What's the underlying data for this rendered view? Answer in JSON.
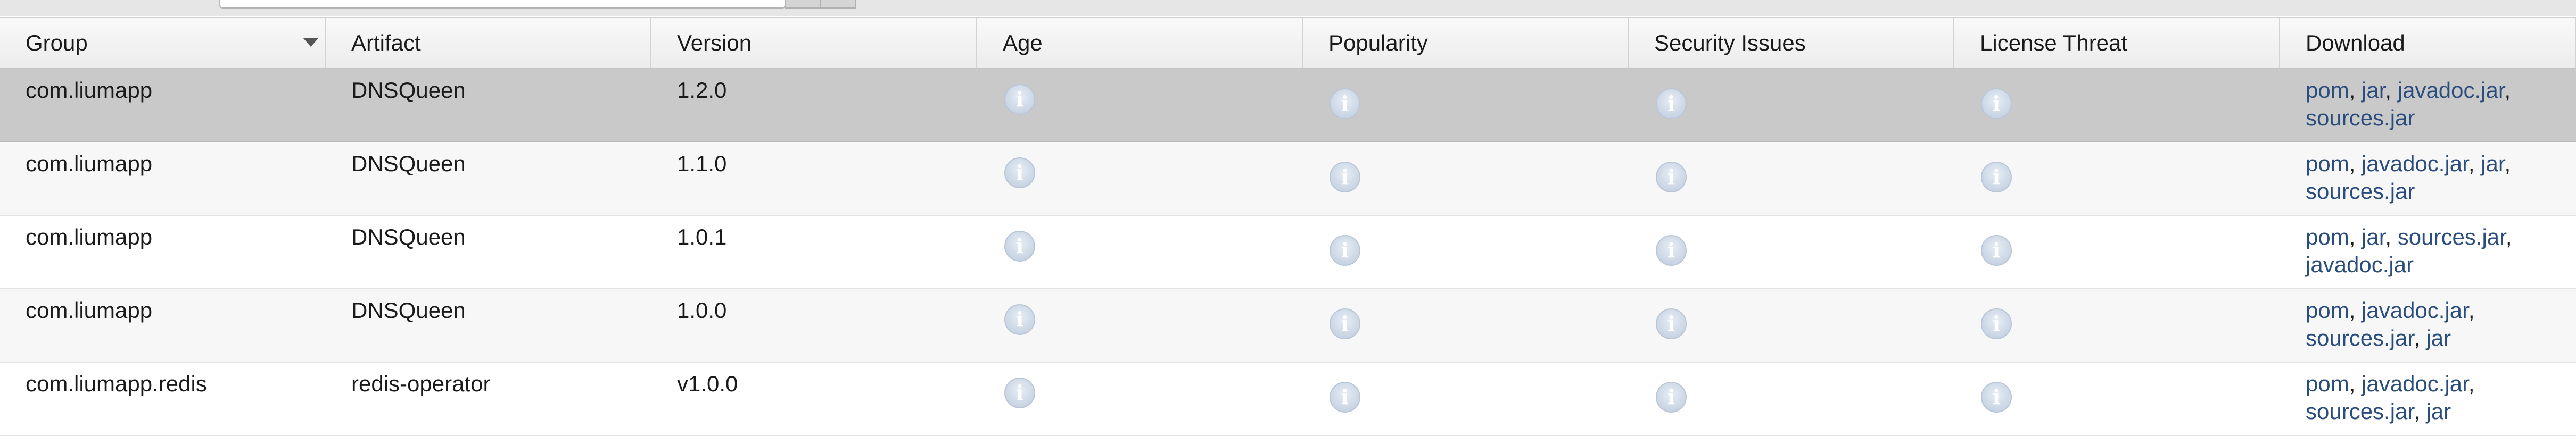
{
  "table": {
    "columns": [
      {
        "label": "Group",
        "sortable": true
      },
      {
        "label": "Artifact"
      },
      {
        "label": "Version"
      },
      {
        "label": "Age"
      },
      {
        "label": "Popularity"
      },
      {
        "label": "Security Issues"
      },
      {
        "label": "License Threat"
      },
      {
        "label": "Download"
      }
    ],
    "rows": [
      {
        "group": "com.liumapp",
        "artifact": "DNSQueen",
        "version": "1.2.0",
        "selected": true,
        "downloads": [
          "pom",
          "jar",
          "javadoc.jar",
          "sources.jar"
        ]
      },
      {
        "group": "com.liumapp",
        "artifact": "DNSQueen",
        "version": "1.1.0",
        "downloads": [
          "pom",
          "javadoc.jar",
          "jar",
          "sources.jar"
        ]
      },
      {
        "group": "com.liumapp",
        "artifact": "DNSQueen",
        "version": "1.0.1",
        "downloads": [
          "pom",
          "jar",
          "sources.jar",
          "javadoc.jar"
        ]
      },
      {
        "group": "com.liumapp",
        "artifact": "DNSQueen",
        "version": "1.0.0",
        "downloads": [
          "pom",
          "javadoc.jar",
          "sources.jar",
          "jar"
        ]
      },
      {
        "group": "com.liumapp.redis",
        "artifact": "redis-operator",
        "version": "v1.0.0",
        "downloads": [
          "pom",
          "javadoc.jar",
          "sources.jar",
          "jar"
        ]
      }
    ]
  },
  "icons": {
    "info": "info-icon",
    "sort": "sort-down-icon"
  },
  "colors": {
    "link": "#2a4d7e",
    "selected_row": "#c9c9c9",
    "header_bg": "#ececec"
  }
}
